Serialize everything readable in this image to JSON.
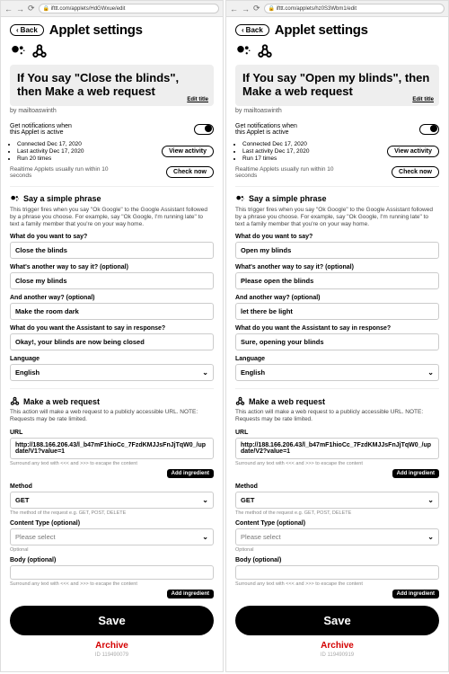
{
  "common": {
    "url_domain": "ifttt.com/applets/",
    "back": "Back",
    "page_title": "Applet settings",
    "edit_title": "Edit title",
    "byline": "by mailtoaswinth",
    "notif_label": "Get notifications when\nthis Applet is active",
    "view_activity": "View activity",
    "check_now": "Check now",
    "realtime": "Realtime Applets usually run within 10 seconds",
    "phrase_hdr": "Say a simple phrase",
    "phrase_desc": "This trigger fires when you say \"Ok Google\" to the Google Assistant followed by a phrase you choose. For example, say \"Ok Google, I'm running late\" to text a family member that you're on your way home.",
    "q1": "What do you want to say?",
    "q2": "What's another way to say it? (optional)",
    "q3": "And another way? (optional)",
    "q4": "What do you want the Assistant to say in response?",
    "language": "Language",
    "web_hdr": "Make a web request",
    "web_desc": "This action will make a web request to a publicly accessible URL. NOTE: Requests may be rate limited.",
    "url_label": "URL",
    "escape_help": "Surround any text with <<< and >>> to escape the content",
    "add_ingr": "Add ingredient",
    "method_label": "Method",
    "method_help": "The method of the request e.g. GET, POST, DELETE",
    "ct_label": "Content Type (optional)",
    "ct_value": "Please select",
    "optional": "Optional",
    "body_label": "Body (optional)",
    "save": "Save",
    "archive": "Archive",
    "english": "English",
    "get": "GET"
  },
  "left": {
    "url_path": "HdGWxue/edit",
    "title": "If You say \"Close the blinds\", then Make a web request",
    "meta": [
      "Connected Dec 17, 2020",
      "Last activity Dec 17, 2020",
      "Run 20 times"
    ],
    "a1": "Close the blinds",
    "a2": "Close my blinds",
    "a3": "Make the room dark",
    "a4": "Okay!, your blinds are now being closed",
    "url_val": "http://188.166.206.43/l_b47mF1hioCc_7FzdKMJJsFnJjTqW0_/update/V1?value=1",
    "id": "ID 119490079"
  },
  "right": {
    "url_path": "hz0S3Wbm1/edit",
    "title": "If You say \"Open my blinds\", then Make a web request",
    "meta": [
      "Connected Dec 17, 2020",
      "Last activity Dec 17, 2020",
      "Run 17 times"
    ],
    "a1": "Open my blinds",
    "a2": "Please open the blinds",
    "a3": "let there be light",
    "a4": "Sure, opening your blinds",
    "url_val": "http://188.166.206.43/l_b47mF1hioCc_7FzdKMJJsFnJjTqW0_/update/V2?value=1",
    "id": "ID 119490919"
  }
}
